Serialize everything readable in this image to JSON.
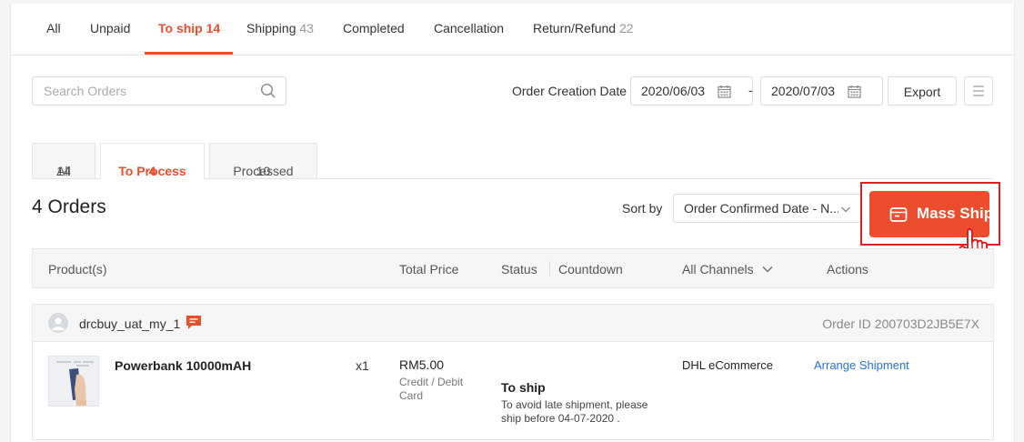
{
  "top_tabs": [
    {
      "label": "All",
      "count": ""
    },
    {
      "label": "Unpaid",
      "count": ""
    },
    {
      "label": "To ship",
      "count": "14"
    },
    {
      "label": "Shipping",
      "count": "43"
    },
    {
      "label": "Completed",
      "count": ""
    },
    {
      "label": "Cancellation",
      "count": ""
    },
    {
      "label": "Return/Refund",
      "count": "22"
    }
  ],
  "active_tab": "To ship",
  "search": {
    "placeholder": "Search Orders"
  },
  "date_filter": {
    "label": "Order Creation Date",
    "from": "2020/06/03",
    "separator": "-",
    "to": "2020/07/03"
  },
  "export_label": "Export",
  "sub_tabs": [
    {
      "label": "All",
      "count": "14"
    },
    {
      "label": "To Process",
      "count": "4"
    },
    {
      "label": "Processed",
      "count": "10"
    }
  ],
  "orders_count": "4 Orders",
  "sort": {
    "label": "Sort by",
    "value": "Order Confirmed Date - N..."
  },
  "mass_ship_label": "Mass Ship",
  "table_headers": {
    "product": "Product(s)",
    "total_price": "Total Price",
    "status": "Status",
    "countdown": "Countdown",
    "channels": "All Channels",
    "actions": "Actions"
  },
  "order": {
    "buyer": "drcbuy_uat_my_1",
    "order_id": "Order ID 200703D2JB5E7X",
    "product_name": "Powerbank 10000mAH",
    "quantity": "x1",
    "price": "RM5.00",
    "payment": "Credit / Debit Card",
    "status": "To ship",
    "status_note": "To avoid late shipment, please ship before 04-07-2020 .",
    "channel": "DHL eCommerce",
    "action": "Arrange Shipment"
  },
  "colors": {
    "accent": "#ee4d2d",
    "link": "#2673dd",
    "highlight_border": "#e02020"
  }
}
